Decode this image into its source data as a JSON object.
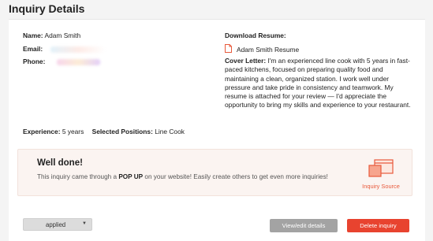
{
  "header": {
    "title": "Inquiry Details"
  },
  "contact": {
    "name_label": "Name:",
    "name_value": "Adam Smith",
    "email_label": "Email:",
    "phone_label": "Phone:"
  },
  "resume": {
    "download_label": "Download Resume:",
    "file_name": "Adam Smith Resume",
    "icon": "pdf-file-icon"
  },
  "cover_letter": {
    "label": "Cover Letter:",
    "text": "I'm an experienced line cook with 5 years in fast-paced kitchens, focused on preparing quality food and maintaining a clean, organized station. I work well under pressure and take pride in consistency and teamwork. My resume is attached for your review — I'd appreciate the opportunity to bring my skills and experience to your restaurant."
  },
  "details": {
    "experience_label": "Experience:",
    "experience_value": "5 years",
    "positions_label": "Selected Positions:",
    "positions_value": "Line Cook"
  },
  "notice": {
    "title": "Well done!",
    "text_before": "This inquiry came through a",
    "text_bold": "POP UP",
    "text_after": "on your website! Easily create others to get even more inquiries!",
    "source_label": "Inquiry Source",
    "source_icon": "popup-window-icon"
  },
  "actions": {
    "status_value": "applied",
    "view_edit_label": "View/edit details",
    "delete_label": "Delete inquiry"
  },
  "colors": {
    "accent": "#e85a3c",
    "delete": "#e8432f",
    "view": "#a3a3a3",
    "notice_bg": "#fbf4f1"
  }
}
